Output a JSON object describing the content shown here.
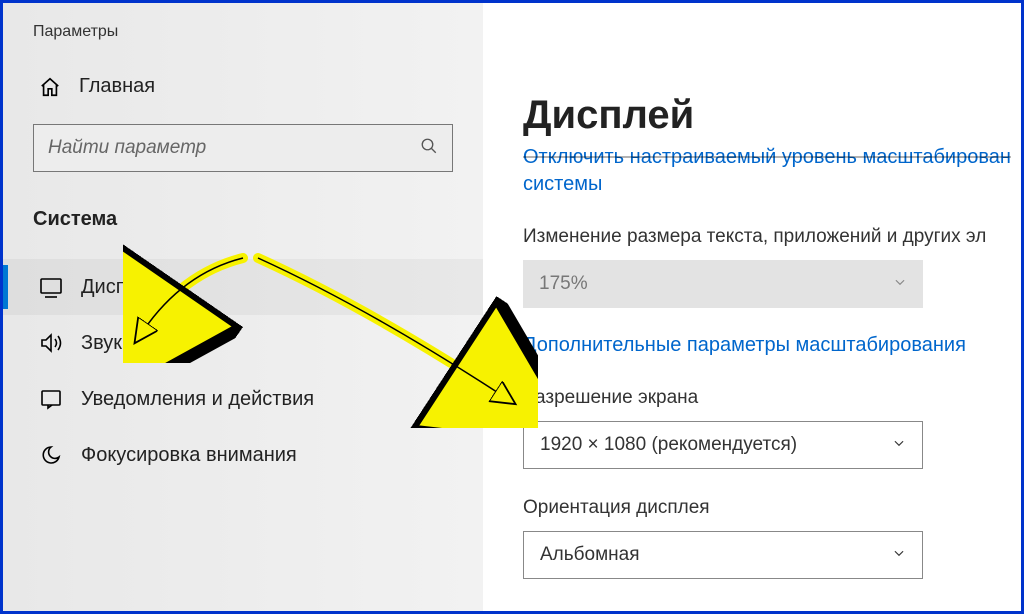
{
  "window": {
    "title": "Параметры"
  },
  "sidebar": {
    "home_label": "Главная",
    "search_placeholder": "Найти параметр",
    "category_label": "Система",
    "items": [
      {
        "label": "Дисплей",
        "icon": "monitor-icon",
        "active": true
      },
      {
        "label": "Звук",
        "icon": "sound-icon",
        "active": false
      },
      {
        "label": "Уведомления и действия",
        "icon": "notifications-icon",
        "active": false
      },
      {
        "label": "Фокусировка внимания",
        "icon": "focus-icon",
        "active": false
      }
    ]
  },
  "main": {
    "heading": "Дисплей",
    "link_disable_scaling": "Отключить настраиваемый уровень масштабирован",
    "link_disable_scaling_2": "системы",
    "label_text_size": "Изменение размера текста, приложений и других эл",
    "scale_value": "175%",
    "link_advanced": "Дополнительные параметры масштабирования",
    "label_resolution": "Разрешение экрана",
    "resolution_value": "1920 × 1080 (рекомендуется)",
    "label_orientation": "Ориентация дисплея",
    "orientation_value": "Альбомная"
  }
}
